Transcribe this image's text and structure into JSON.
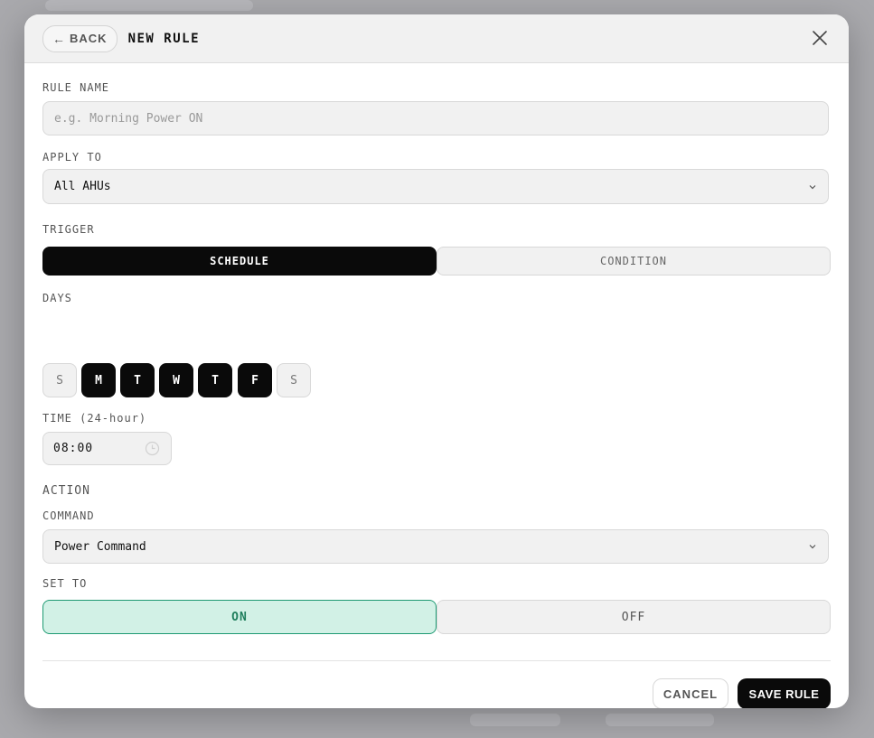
{
  "header": {
    "back_arrow": "←",
    "back_label": "BACK",
    "title": "NEW RULE"
  },
  "rule_name": {
    "label": "RULE NAME",
    "value": "",
    "placeholder": "e.g. Morning Power ON"
  },
  "apply_to": {
    "label": "APPLY TO",
    "selected": "All AHUs"
  },
  "trigger": {
    "label": "TRIGGER",
    "options": [
      "SCHEDULE",
      "CONDITION"
    ],
    "selected": "SCHEDULE"
  },
  "days": {
    "label": "DAYS",
    "items": [
      {
        "letter": "S",
        "selected": false
      },
      {
        "letter": "M",
        "selected": true
      },
      {
        "letter": "T",
        "selected": true
      },
      {
        "letter": "W",
        "selected": true
      },
      {
        "letter": "T",
        "selected": true
      },
      {
        "letter": "F",
        "selected": true
      },
      {
        "letter": "S",
        "selected": false
      }
    ]
  },
  "time": {
    "label": "TIME (24-hour)",
    "value": "08:00"
  },
  "action": {
    "label": "ACTION",
    "command_label": "COMMAND",
    "command_selected": "Power Command",
    "set_to_label": "SET TO",
    "set_to_options": [
      "ON",
      "OFF"
    ],
    "set_to_selected": "ON"
  },
  "footer": {
    "cancel_label": "CANCEL",
    "save_label": "SAVE RULE"
  },
  "colors": {
    "accent": "#0a0a0a",
    "on_bg": "#d2f1e6",
    "on_border": "#1e9a72",
    "on_text": "#1e7e5c"
  },
  "icons": {
    "close": "close-icon",
    "chevron": "chevron-down-icon",
    "clock": "clock-icon"
  }
}
